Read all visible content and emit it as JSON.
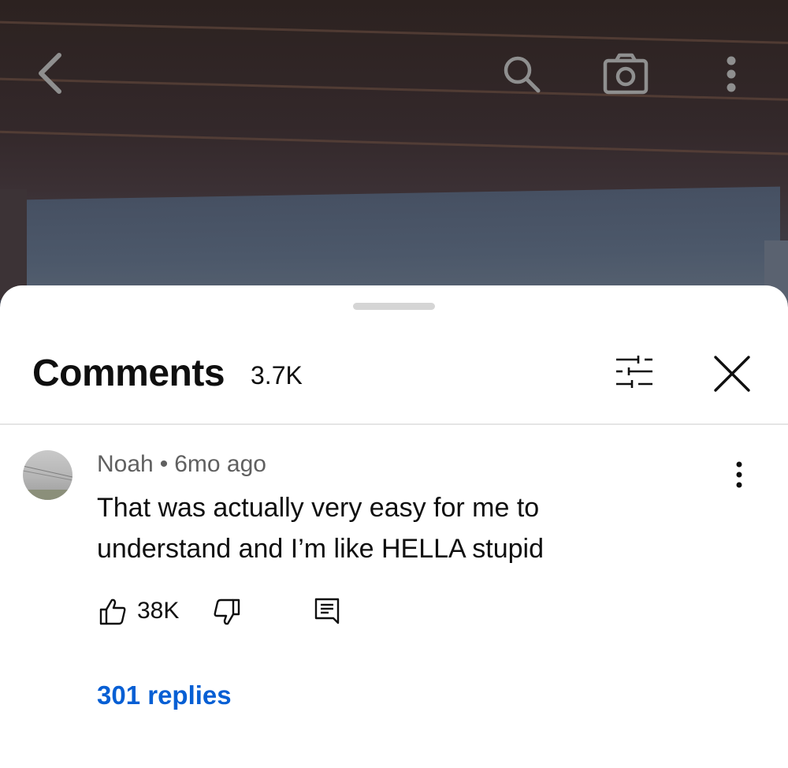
{
  "video_overlay": {
    "icons": [
      "back-chevron-icon",
      "search-icon",
      "camera-icon",
      "more-vertical-icon"
    ]
  },
  "comments_panel": {
    "title": "Comments",
    "count": "3.7K",
    "icons": [
      "sort-filter-icon",
      "close-icon"
    ]
  },
  "comment": {
    "author": "Noah",
    "separator": "•",
    "time": "6mo ago",
    "text": "That was actually very easy for me to understand and I’m like HELLA stupid",
    "likes": "38K",
    "replies": "301 replies",
    "icons": [
      "thumbs-up-icon",
      "thumbs-down-icon",
      "reply-comment-icon",
      "more-vertical-icon"
    ]
  },
  "colors": {
    "link": "#065fd4",
    "text": "#0f0f0f",
    "meta": "#606060"
  }
}
